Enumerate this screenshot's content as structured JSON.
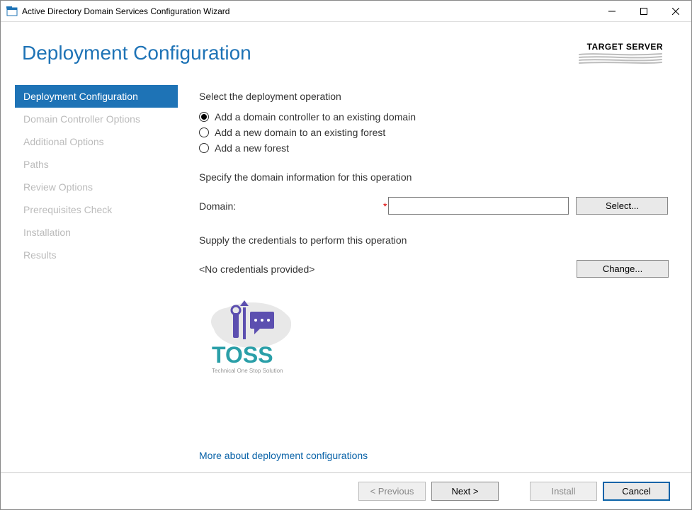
{
  "window": {
    "title": "Active Directory Domain Services Configuration Wizard"
  },
  "header": {
    "page_title": "Deployment Configuration",
    "target_label": "TARGET SERVER"
  },
  "steps": [
    {
      "label": "Deployment Configuration",
      "active": true
    },
    {
      "label": "Domain Controller Options",
      "active": false
    },
    {
      "label": "Additional Options",
      "active": false
    },
    {
      "label": "Paths",
      "active": false
    },
    {
      "label": "Review Options",
      "active": false
    },
    {
      "label": "Prerequisites Check",
      "active": false
    },
    {
      "label": "Installation",
      "active": false
    },
    {
      "label": "Results",
      "active": false
    }
  ],
  "content": {
    "select_op_label": "Select the deployment operation",
    "radios": [
      {
        "label": "Add a domain controller to an existing domain",
        "checked": true
      },
      {
        "label": "Add a new domain to an existing forest",
        "checked": false
      },
      {
        "label": "Add a new forest",
        "checked": false
      }
    ],
    "specify_domain_label": "Specify the domain information for this operation",
    "domain_label": "Domain:",
    "domain_value": "",
    "select_button": "Select...",
    "supply_cred_label": "Supply the credentials to perform this operation",
    "no_cred_text": "<No credentials provided>",
    "change_button": "Change...",
    "more_link": "More about deployment configurations",
    "logo_text": "TOSS",
    "logo_sub": "Technical One Stop Solution"
  },
  "footer": {
    "previous": "< Previous",
    "next": "Next >",
    "install": "Install",
    "cancel": "Cancel"
  }
}
